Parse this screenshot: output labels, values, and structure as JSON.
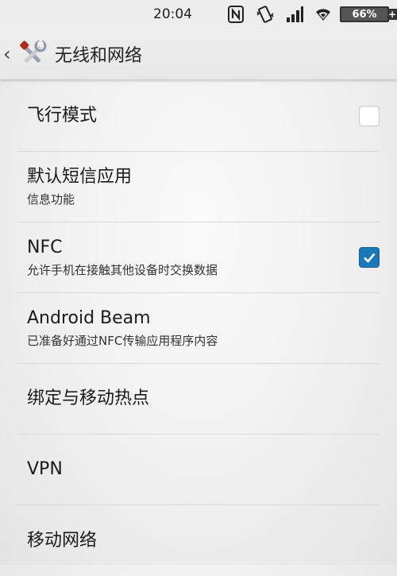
{
  "status_bar": {
    "time": "20:04",
    "icons": [
      "nfc-icon",
      "vibrate-icon",
      "signal-icon",
      "wifi-icon"
    ],
    "battery": "66%"
  },
  "action_bar": {
    "title": "无线和网络",
    "app_icon": "settings-tools-icon"
  },
  "settings": [
    {
      "title": "飞行模式",
      "subtitle": "",
      "checkbox": false
    },
    {
      "title": "默认短信应用",
      "subtitle": "信息功能"
    },
    {
      "title": "NFC",
      "subtitle": "允许手机在接触其他设备时交换数据",
      "checkbox": true
    },
    {
      "title": "Android Beam",
      "subtitle": "已准备好通过NFC传输应用程序内容"
    },
    {
      "title": "绑定与移动热点",
      "subtitle": ""
    },
    {
      "title": "VPN",
      "subtitle": ""
    },
    {
      "title": "移动网络",
      "subtitle": ""
    }
  ],
  "colors": {
    "accent": "#1a78b8"
  }
}
